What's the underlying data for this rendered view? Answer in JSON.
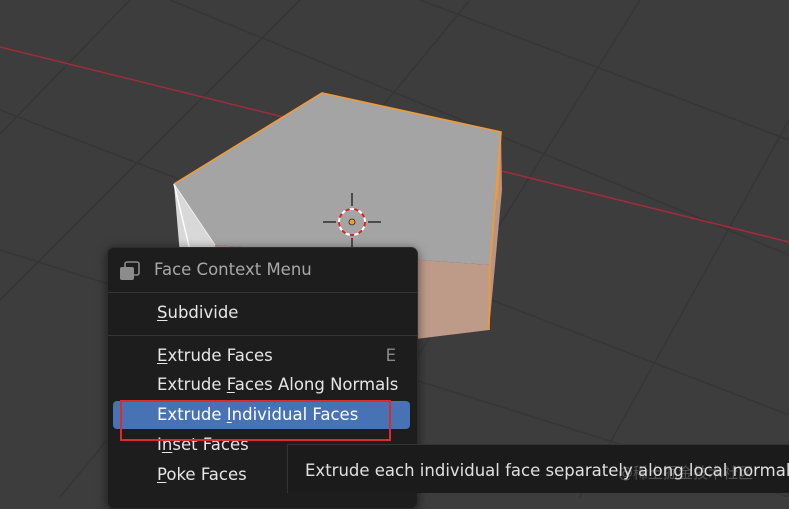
{
  "colors": {
    "background": "#3d3d3d",
    "grid": "#363636",
    "x_axis": "#a12c38",
    "face_top": "#a4a4a4",
    "face_side": "#be9a88",
    "selection_edge": "#f29a35",
    "menu_bg": "#1d1d1d",
    "menu_highlight": "#4772b3",
    "annotation_box": "#e02a2a"
  },
  "icons": {
    "header": "cube-menu-icon",
    "cursor": "3d-cursor-icon",
    "origin": "object-origin-dot"
  },
  "context_menu": {
    "title": "Face Context Menu",
    "items": [
      {
        "pre": "",
        "key": "S",
        "post": "ubdivide",
        "shortcut": ""
      },
      {
        "pre": "",
        "key": "E",
        "post": "xtrude Faces",
        "shortcut": "E"
      },
      {
        "pre": "Extrude ",
        "key": "F",
        "post": "aces Along Normals",
        "shortcut": ""
      },
      {
        "pre": "Extrude ",
        "key": "I",
        "post": "ndividual Faces",
        "shortcut": ""
      },
      {
        "pre": "I",
        "key": "n",
        "post": "set Faces",
        "shortcut": ""
      },
      {
        "pre": "",
        "key": "P",
        "post": "oke Faces",
        "shortcut": ""
      }
    ]
  },
  "tooltip": {
    "text": "Extrude each individual face separately along local normals.",
    "watermark": "@稀土掘金技术社区"
  }
}
